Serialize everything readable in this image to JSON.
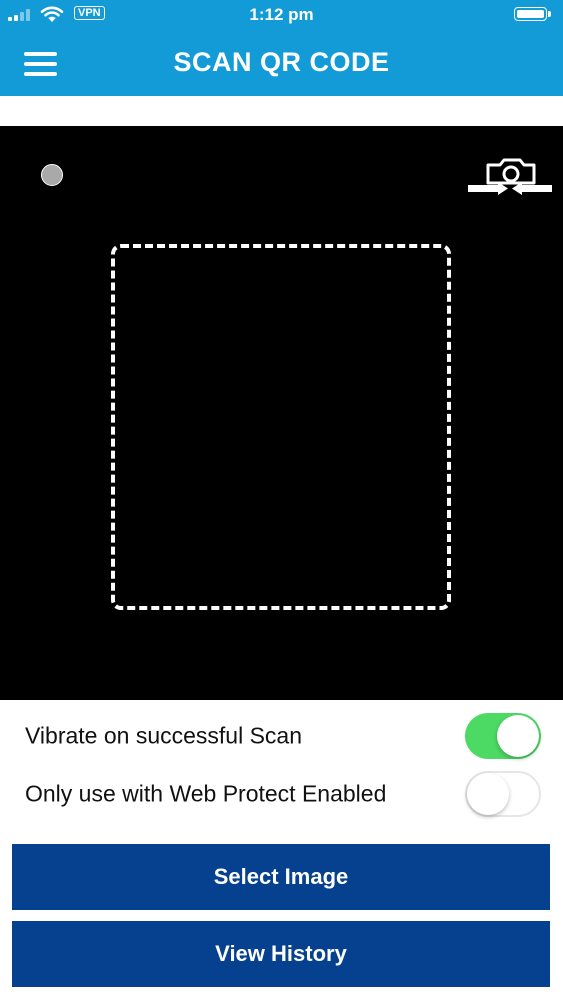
{
  "status_bar": {
    "time": "1:12 pm",
    "vpn_label": "VPN",
    "icons": [
      "cellular-signal-icon",
      "wifi-icon",
      "battery-icon"
    ]
  },
  "header": {
    "title": "SCAN QR CODE",
    "menu_icon": "hamburger-menu-icon",
    "background_color": "#139bd8"
  },
  "camera_view": {
    "flash_icon": "flash-indicator-icon",
    "switch_camera_icon": "switch-camera-icon",
    "frame_icon": "scan-frame"
  },
  "options": [
    {
      "label": "Vibrate on successful Scan",
      "enabled": true
    },
    {
      "label": "Only use with Web Protect Enabled",
      "enabled": false
    }
  ],
  "buttons": {
    "select_image": "Select Image",
    "view_history": "View History",
    "color": "#06418f"
  },
  "toggle_on_color": "#4cd964"
}
